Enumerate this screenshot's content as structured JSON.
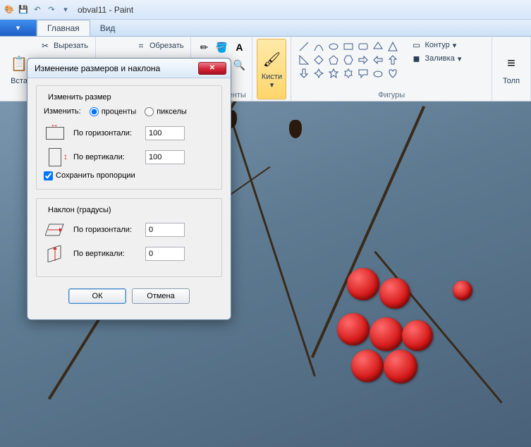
{
  "titlebar": {
    "doc": "obval11",
    "app": "Paint"
  },
  "tabs": {
    "home": "Главная",
    "view": "Вид"
  },
  "ribbon": {
    "clipboard": {
      "paste": "Вста",
      "cut": "Вырезать"
    },
    "image": {
      "crop": "Обрезать"
    },
    "tools": {
      "label": "Инструменты"
    },
    "brushes": {
      "label": "Кисти"
    },
    "shapes": {
      "label": "Фигуры",
      "outline": "Контур",
      "fill": "Заливка"
    },
    "size": {
      "label": "Толп"
    }
  },
  "dialog": {
    "title": "Изменение размеров и наклона",
    "resize_section": "Изменить размер",
    "by_label": "Изменить:",
    "percent": "проценты",
    "pixels": "пикселы",
    "horizontal": "По горизонтали:",
    "vertical": "По вертикали:",
    "h_value": "100",
    "v_value": "100",
    "aspect": "Сохранить пропорции",
    "skew_section": "Наклон (градусы)",
    "skew_h": "По горизонтали:",
    "skew_v": "По вертикали:",
    "skew_h_value": "0",
    "skew_v_value": "0",
    "ok": "ОК",
    "cancel": "Отмена"
  }
}
